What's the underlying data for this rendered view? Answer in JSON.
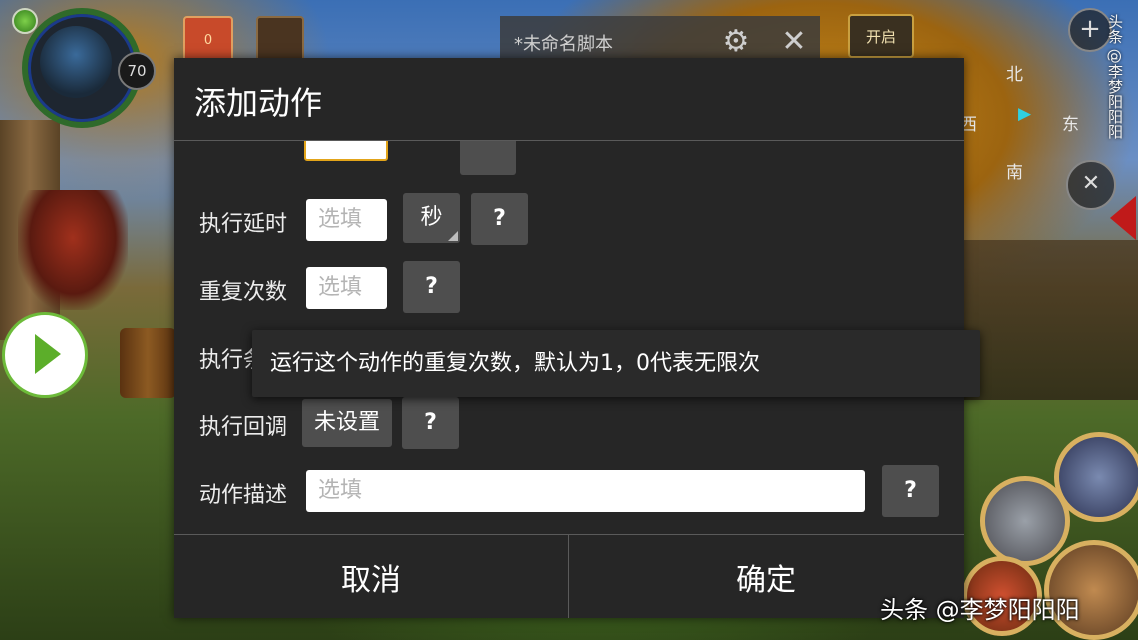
{
  "hud": {
    "level": "70",
    "gem_count": "0"
  },
  "script_bar": {
    "script_name": "*未命名脚本",
    "start_label": "开启"
  },
  "compass": {
    "north": "北",
    "east": "东",
    "west": "西",
    "south": "南"
  },
  "dialog": {
    "title": "添加动作",
    "rows": {
      "delay_label": "执行延时",
      "delay_placeholder": "选填",
      "delay_unit": "秒",
      "repeat_label": "重复次数",
      "repeat_placeholder": "选填",
      "condition_label": "执行条",
      "callback_label": "执行回调",
      "callback_value": "未设置",
      "desc_label": "动作描述",
      "desc_placeholder": "选填",
      "help": "?"
    },
    "cancel_label": "取消",
    "confirm_label": "确定"
  },
  "tooltip": {
    "text": "运行这个动作的重复次数，默认为1，0代表无限次"
  },
  "watermark": {
    "vertical": "头条 @李梦阳阳阳",
    "bottom": "头条 @李梦阳阳阳"
  },
  "colors": {
    "dialog_bg": "#262626",
    "button_gray": "#4e4e4e",
    "focus_border": "#e2a41a",
    "play_green": "#5cae2a"
  }
}
